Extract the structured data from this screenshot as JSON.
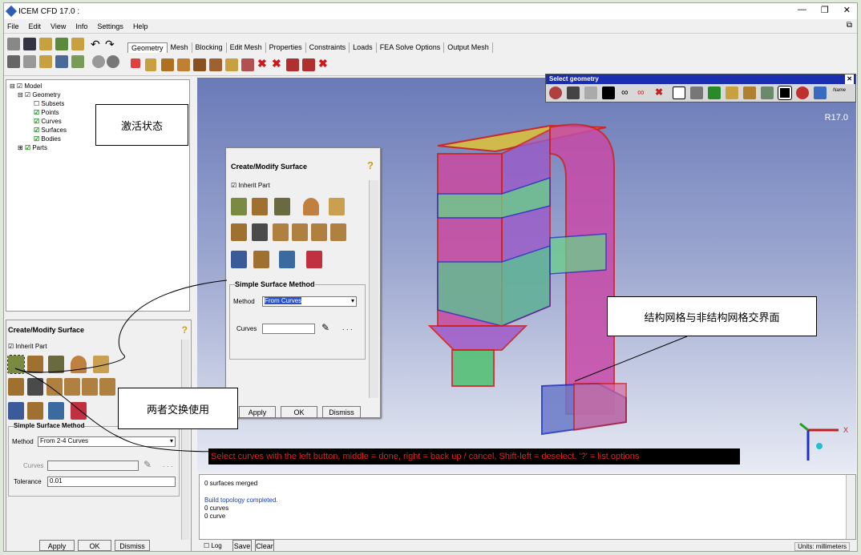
{
  "window": {
    "title": "ICEM CFD 17.0 :"
  },
  "menu": [
    "File",
    "Edit",
    "View",
    "Info",
    "Settings",
    "Help"
  ],
  "tabs": [
    "Geometry",
    "Mesh",
    "Blocking",
    "Edit Mesh",
    "Properties",
    "Constraints",
    "Loads",
    "FEA Solve Options",
    "Output Mesh"
  ],
  "tree": [
    "Model",
    "Geometry",
    "Subsets",
    "Points",
    "Curves",
    "Surfaces",
    "Bodies",
    "Parts"
  ],
  "left_panel": {
    "title": "Create/Modify Surface",
    "inherit": "Inherit Part",
    "group": "Simple Surface Method",
    "method_label": "Method",
    "method_value": "From 2-4 Curves",
    "curves_label": "Curves",
    "tolerance_label": "Tolerance",
    "tolerance_value": "0.01",
    "apply": "Apply",
    "ok": "OK",
    "dismiss": "Dismiss"
  },
  "float_panel": {
    "title": "Create/Modify Surface",
    "inherit": "Inherit Part",
    "group": "Simple Surface Method",
    "method_label": "Method",
    "method_value": "From Curves",
    "curves_label": "Curves",
    "apply": "Apply",
    "ok": "OK",
    "dismiss": "Dismiss"
  },
  "select_geometry": {
    "title": "Select geometry"
  },
  "version": "R17.0",
  "status_bar": "Select curves with the left button, middle = done, right = back up / cancel, Shift-left = deselect, '?' = list options",
  "console": [
    "0 surfaces merged",
    "Build topology completed.",
    "0 curves",
    "0 curve"
  ],
  "bottom": {
    "log": "Log",
    "save": "Save",
    "clear": "Clear",
    "units": "Units: millimeters"
  },
  "annotations": {
    "active": "激活状态",
    "interface": "结构网格与非结构网格交界面",
    "swap": "两者交换使用"
  },
  "colors": {
    "accent": "#1a2fb0",
    "status_red": "#e02020"
  }
}
